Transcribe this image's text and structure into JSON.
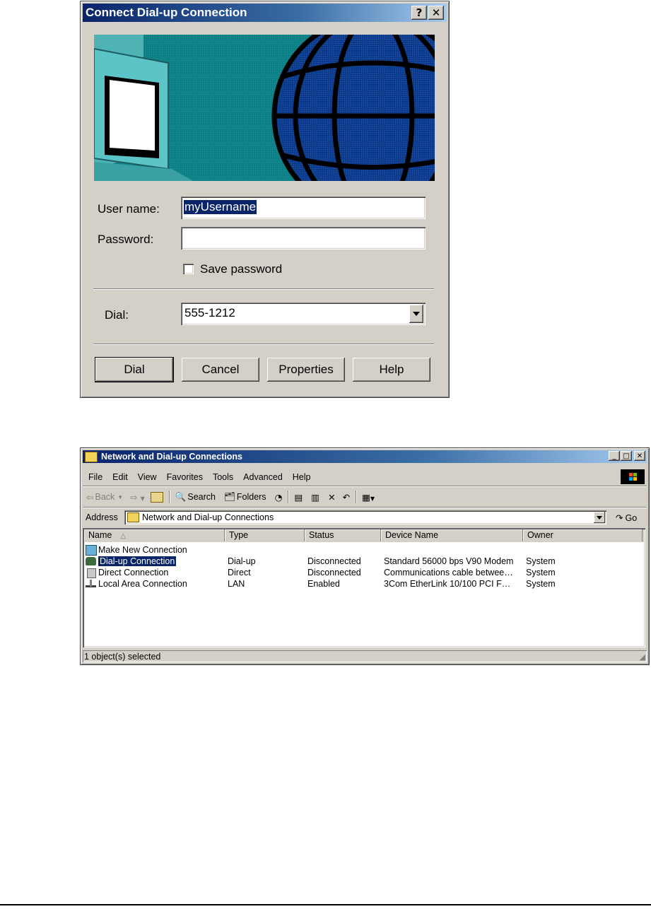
{
  "dialog": {
    "title": "Connect Dial-up Connection",
    "help_button": "?",
    "close_button": "✕",
    "username_label": "User name:",
    "username_value": "myUsername",
    "password_label": "Password:",
    "password_value": "",
    "save_password_label": "Save password",
    "save_password_checked": false,
    "dial_label": "Dial:",
    "dial_value": "555-1212",
    "buttons": {
      "dial": "Dial",
      "cancel": "Cancel",
      "properties": "Properties",
      "help": "Help"
    }
  },
  "explorer": {
    "title": "Network and Dial-up Connections",
    "menu": [
      "File",
      "Edit",
      "View",
      "Favorites",
      "Tools",
      "Advanced",
      "Help"
    ],
    "toolbar": {
      "back": "Back",
      "search": "Search",
      "folders": "Folders"
    },
    "address_label": "Address",
    "address_value": "Network and Dial-up Connections",
    "go_label": "Go",
    "columns": [
      "Name",
      "Type",
      "Status",
      "Device Name",
      "Owner"
    ],
    "rows": [
      {
        "name": "Make New Connection",
        "type": "",
        "status": "",
        "device": "",
        "owner": ""
      },
      {
        "name": "Dial-up Connection",
        "type": "Dial-up",
        "status": "Disconnected",
        "device": "Standard 56000 bps V90 Modem",
        "owner": "System",
        "selected": true
      },
      {
        "name": "Direct Connection",
        "type": "Direct",
        "status": "Disconnected",
        "device": "Communications cable betwee…",
        "owner": "System"
      },
      {
        "name": "Local Area Connection",
        "type": "LAN",
        "status": "Enabled",
        "device": "3Com EtherLink 10/100 PCI F…",
        "owner": "System"
      }
    ],
    "status_text": "1 object(s) selected"
  },
  "colors": {
    "title_start": "#0a246a",
    "title_end": "#a6caf0",
    "face": "#d4d0c8",
    "selection": "#0a246a"
  }
}
